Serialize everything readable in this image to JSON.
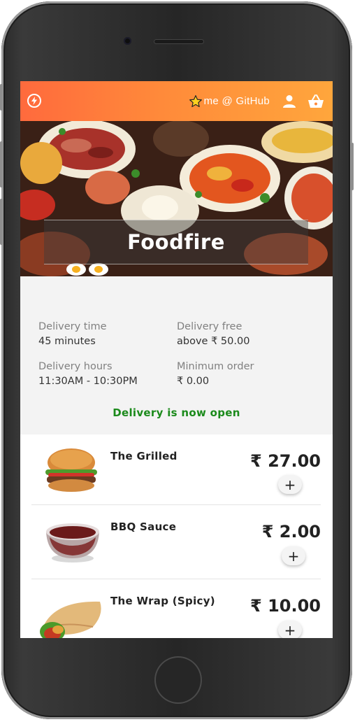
{
  "header": {
    "github_link": "me @ GitHub",
    "icons": [
      "bolt-logo-icon",
      "star-icon",
      "user-icon",
      "basket-icon"
    ]
  },
  "hero": {
    "title": "Foodfire"
  },
  "info": {
    "delivery_time_label": "Delivery time",
    "delivery_time_value": "45 minutes",
    "delivery_free_label": "Delivery free",
    "delivery_free_value": "above ₹ 50.00",
    "delivery_hours_label": "Delivery hours",
    "delivery_hours_value": "11:30AM - 10:30PM",
    "minimum_order_label": "Minimum order",
    "minimum_order_value": "₹ 0.00",
    "status": "Delivery is now open"
  },
  "menu": {
    "items": [
      {
        "name": "The Grilled",
        "price": "₹ 27.00",
        "add": "+"
      },
      {
        "name": "BBQ Sauce",
        "price": "₹ 2.00",
        "add": "+"
      },
      {
        "name": "The Wrap (Spicy)",
        "price": "₹ 10.00",
        "add": "+"
      }
    ]
  },
  "colors": {
    "header_start": "#ff6a3d",
    "header_end": "#ffa63c",
    "status_green": "#1b8a1b",
    "info_bg": "#f3f3f3"
  }
}
